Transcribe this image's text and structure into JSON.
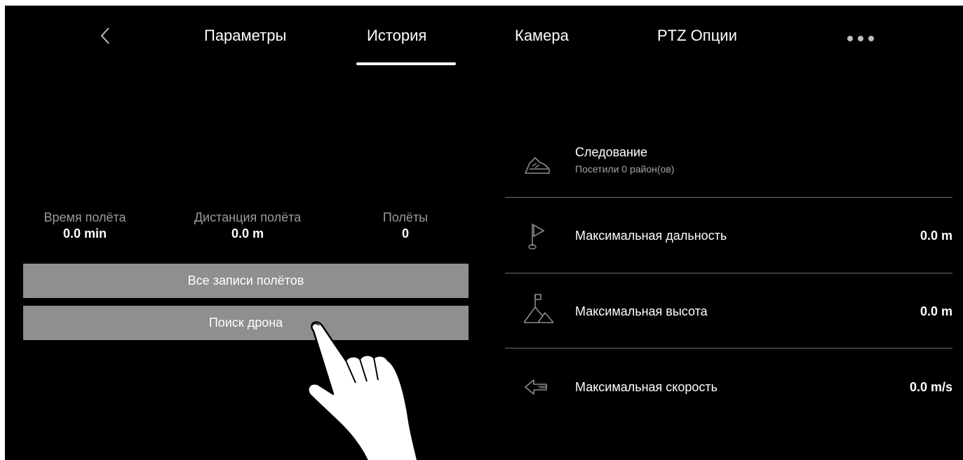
{
  "tabs": {
    "params": "Параметры",
    "history": "История",
    "camera": "Камера",
    "ptz": "PTZ Опции"
  },
  "stats": {
    "flight_time_label": "Время полёта",
    "flight_time_value": "0.0 min",
    "flight_distance_label": "Дистанция полёта",
    "flight_distance_value": "0.0 m",
    "flights_label": "Полёты",
    "flights_value": "0"
  },
  "buttons": {
    "all_records": "Все записи полётов",
    "find_drone": "Поиск дрона"
  },
  "records": {
    "follow_title": "Следование",
    "follow_subtitle": "Посетили 0 район(ов)",
    "max_range_label": "Максимальная дальность",
    "max_range_value": "0.0 m",
    "max_height_label": "Максимальная высота",
    "max_height_value": "0.0 m",
    "max_speed_label": "Максимальная скорость",
    "max_speed_value": "0.0 m/s"
  }
}
